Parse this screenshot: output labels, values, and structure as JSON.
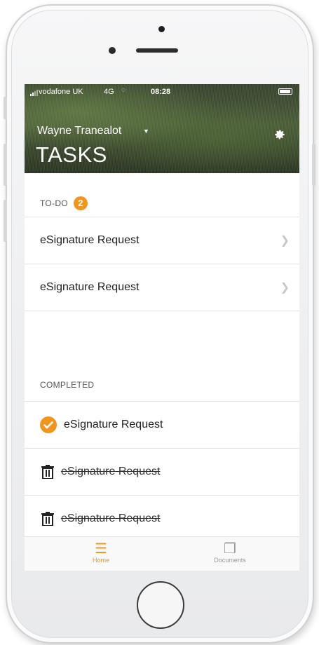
{
  "status_bar": {
    "carrier": "vodafone UK",
    "network": "4G",
    "time": "08:28"
  },
  "header": {
    "user_name": "Wayne Tranealot",
    "title": "TASKS"
  },
  "todo": {
    "label": "TO-DO",
    "count": "2",
    "items": [
      {
        "label": "eSignature Request"
      },
      {
        "label": "eSignature Request"
      }
    ]
  },
  "completed": {
    "label": "COMPLETED",
    "items": [
      {
        "label": "eSignature Request",
        "state": "completed",
        "icon": "check-icon"
      },
      {
        "label": "eSignature Request",
        "state": "deleted",
        "icon": "trash-icon"
      },
      {
        "label": "eSignature Request",
        "state": "deleted",
        "icon": "trash-icon"
      }
    ]
  },
  "tabbar": {
    "tabs": [
      {
        "label": "Home",
        "icon": "menu-icon",
        "active": true
      },
      {
        "label": "Documents",
        "icon": "documents-icon",
        "active": false
      }
    ]
  },
  "colors": {
    "accent": "#f0951d",
    "divider": "#e4e4e4"
  }
}
